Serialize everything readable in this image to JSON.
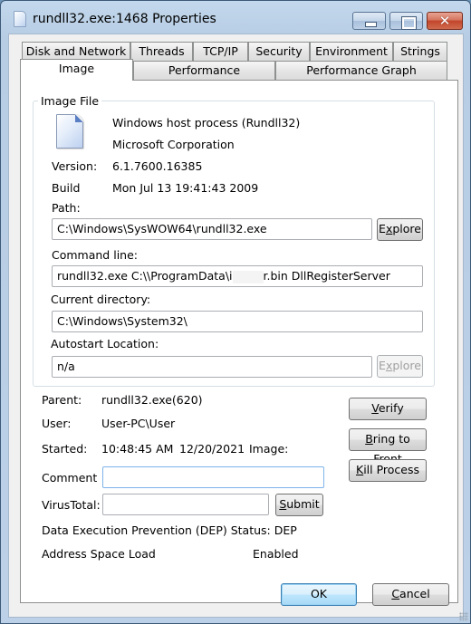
{
  "window": {
    "title": "rundll32.exe:1468 Properties",
    "controls": {
      "minimize": "minimize",
      "maximize": "maximize",
      "close": "✕"
    }
  },
  "tabs": {
    "row1": [
      "Disk and Network",
      "Threads",
      "TCP/IP",
      "Security",
      "Environment",
      "Strings"
    ],
    "row2": [
      "Image",
      "Performance",
      "Performance Graph"
    ],
    "active": "Image"
  },
  "image_file": {
    "group_label": "Image File",
    "icon": "file-icon",
    "description": "Windows host process (Rundll32)",
    "company": "Microsoft Corporation",
    "version_label": "Version:",
    "version_value": "6.1.7600.16385",
    "build_label": "Build",
    "build_value": "Mon Jul 13 19:41:43 2009",
    "path_label": "Path:",
    "path_value": "C:\\Windows\\SysWOW64\\rundll32.exe",
    "explore_label_pre": "E",
    "explore_label_mn": "x",
    "explore_label_post": "plore",
    "cmdline_label": "Command line:",
    "cmdline_value_pre": "rundll32.exe C:\\\\ProgramData\\i",
    "cmdline_value_post": "r.bin DllRegisterServer",
    "curdir_label": "Current directory:",
    "curdir_value": "C:\\Windows\\System32\\",
    "autostart_label": "Autostart Location:",
    "autostart_value": "n/a"
  },
  "process": {
    "parent_label": "Parent:",
    "parent_value": "rundll32.exe(620)",
    "user_label": "User:",
    "user_value": "User-PC\\User",
    "started_label": "Started:",
    "started_time": "10:48:45 AM",
    "started_date": "12/20/2021",
    "started_image_label": "Image:",
    "comment_label": "Comment",
    "comment_value": "",
    "virustotal_label": "VirusTotal:",
    "virustotal_value": "",
    "dep_text": "Data Execution Prevention (DEP) Status: DEP",
    "aslr_label": "Address Space Load",
    "aslr_value": "Enabled"
  },
  "buttons": {
    "verify": {
      "mn": "V",
      "rest": "erify"
    },
    "bring_to_front": {
      "mn": "B",
      "rest": "ring to Front"
    },
    "kill_process": {
      "mn": "K",
      "rest": "ill Process"
    },
    "submit": {
      "mn": "S",
      "rest": "ubmit"
    },
    "ok": "OK",
    "cancel": {
      "mn": "C",
      "rest": "ancel"
    }
  }
}
